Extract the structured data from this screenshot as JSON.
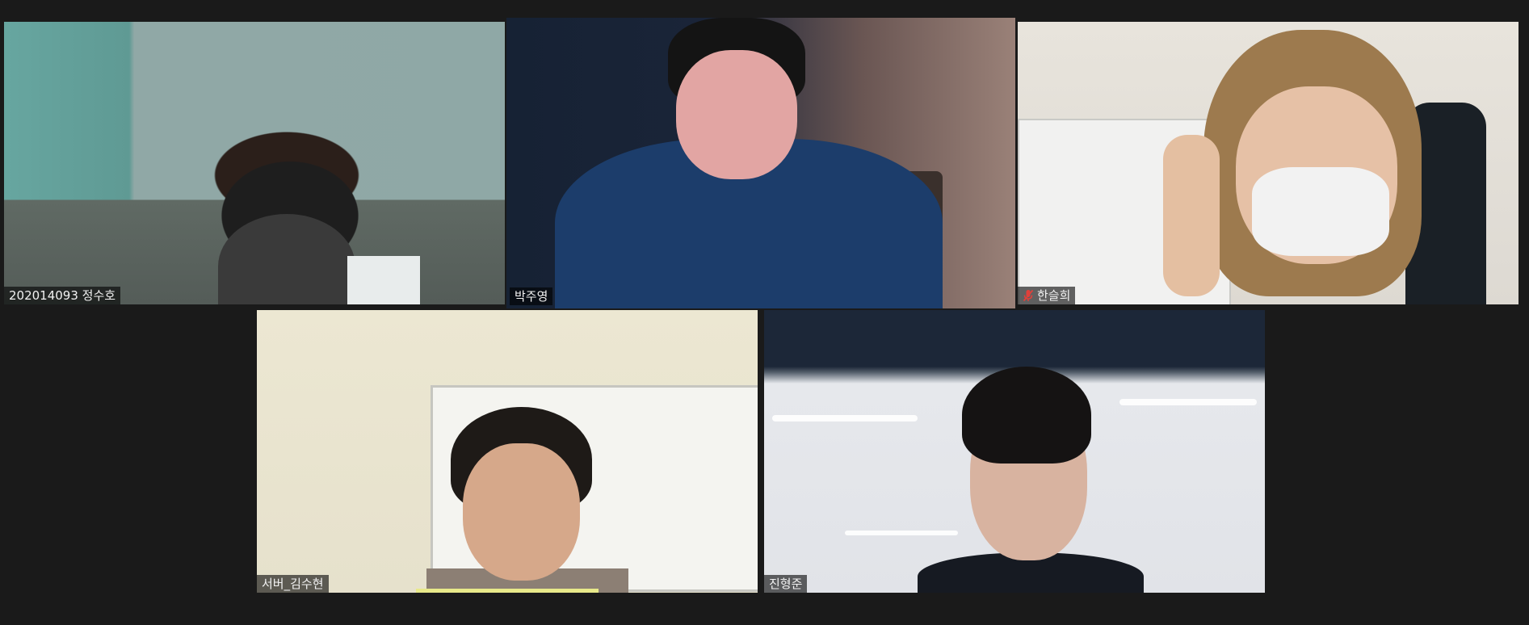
{
  "app": {
    "view": "gallery"
  },
  "participants": [
    {
      "name": "202014093 정수호",
      "muted": false,
      "active_speaker": false
    },
    {
      "name": "박주영",
      "muted": false,
      "active_speaker": true
    },
    {
      "name": "한슬희",
      "muted": true,
      "active_speaker": false
    },
    {
      "name": "서버_김수현",
      "muted": false,
      "active_speaker": false
    },
    {
      "name": "진형준",
      "muted": false,
      "active_speaker": false
    }
  ],
  "colors": {
    "background": "#1a1a1a",
    "active_speaker_border": "#d6ec6c",
    "muted_icon": "#e0403a"
  },
  "icons": {
    "mute": "microphone-muted-icon"
  }
}
